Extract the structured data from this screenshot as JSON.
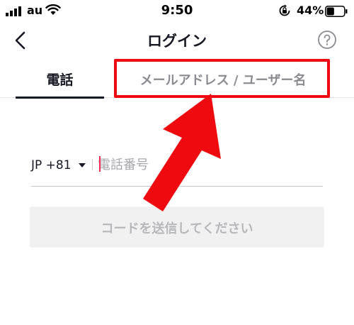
{
  "status_bar": {
    "carrier": "au",
    "time": "9:50",
    "battery_percent": "44%",
    "battery_level": 0.44,
    "icons": [
      "signal-icon",
      "wifi-icon",
      "rotation-lock-icon",
      "battery-icon"
    ]
  },
  "nav": {
    "title": "ログイン",
    "back_icon": "chevron-left-icon",
    "help_icon": "question-mark-icon"
  },
  "tabs": [
    {
      "label": "電話",
      "selected": true
    },
    {
      "label": "メールアドレス / ユーザー名",
      "selected": false
    }
  ],
  "phone_form": {
    "country_code": "JP +81",
    "phone_placeholder": "電話番号",
    "phone_value": ""
  },
  "send_code_button": {
    "label": "コードを送信してください",
    "enabled": false
  },
  "colors": {
    "text_primary": "#161823",
    "text_muted": "#8a8b91",
    "highlight_red": "#ef0a0f",
    "caret_pink": "#fe2c55",
    "button_disabled_bg": "#f1f1f2"
  }
}
